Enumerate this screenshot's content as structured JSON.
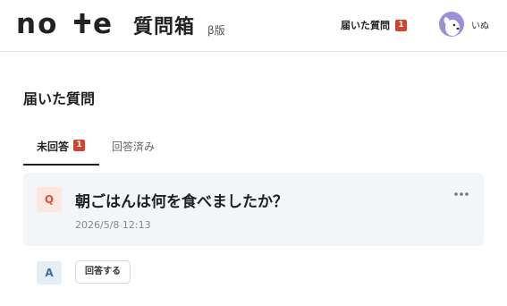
{
  "header": {
    "brand": "note",
    "product_name": "質問箱",
    "beta_label": "β版",
    "received_link": "届いた質問",
    "received_count": "1",
    "username": "いぬ"
  },
  "page": {
    "title": "届いた質問"
  },
  "tabs": [
    {
      "label": "未回答",
      "badge": "1",
      "active": true
    },
    {
      "label": "回答済み",
      "active": false
    }
  ],
  "question": {
    "marker": "Q",
    "text": "朝ごはんは何を食べましたか？",
    "date": "2026/5/8 12:13"
  },
  "answer": {
    "marker": "A",
    "button_label": "回答する"
  },
  "colors": {
    "badge": "#d0452f",
    "q_marker_bg": "#fbe6e0",
    "a_marker_bg": "#e3eef7",
    "card_bg": "#f3f6f8",
    "avatar_bg": "#9b8fd6"
  },
  "icons": [
    "note-logo",
    "avatar-dog-icon",
    "more-horizontal-icon"
  ]
}
